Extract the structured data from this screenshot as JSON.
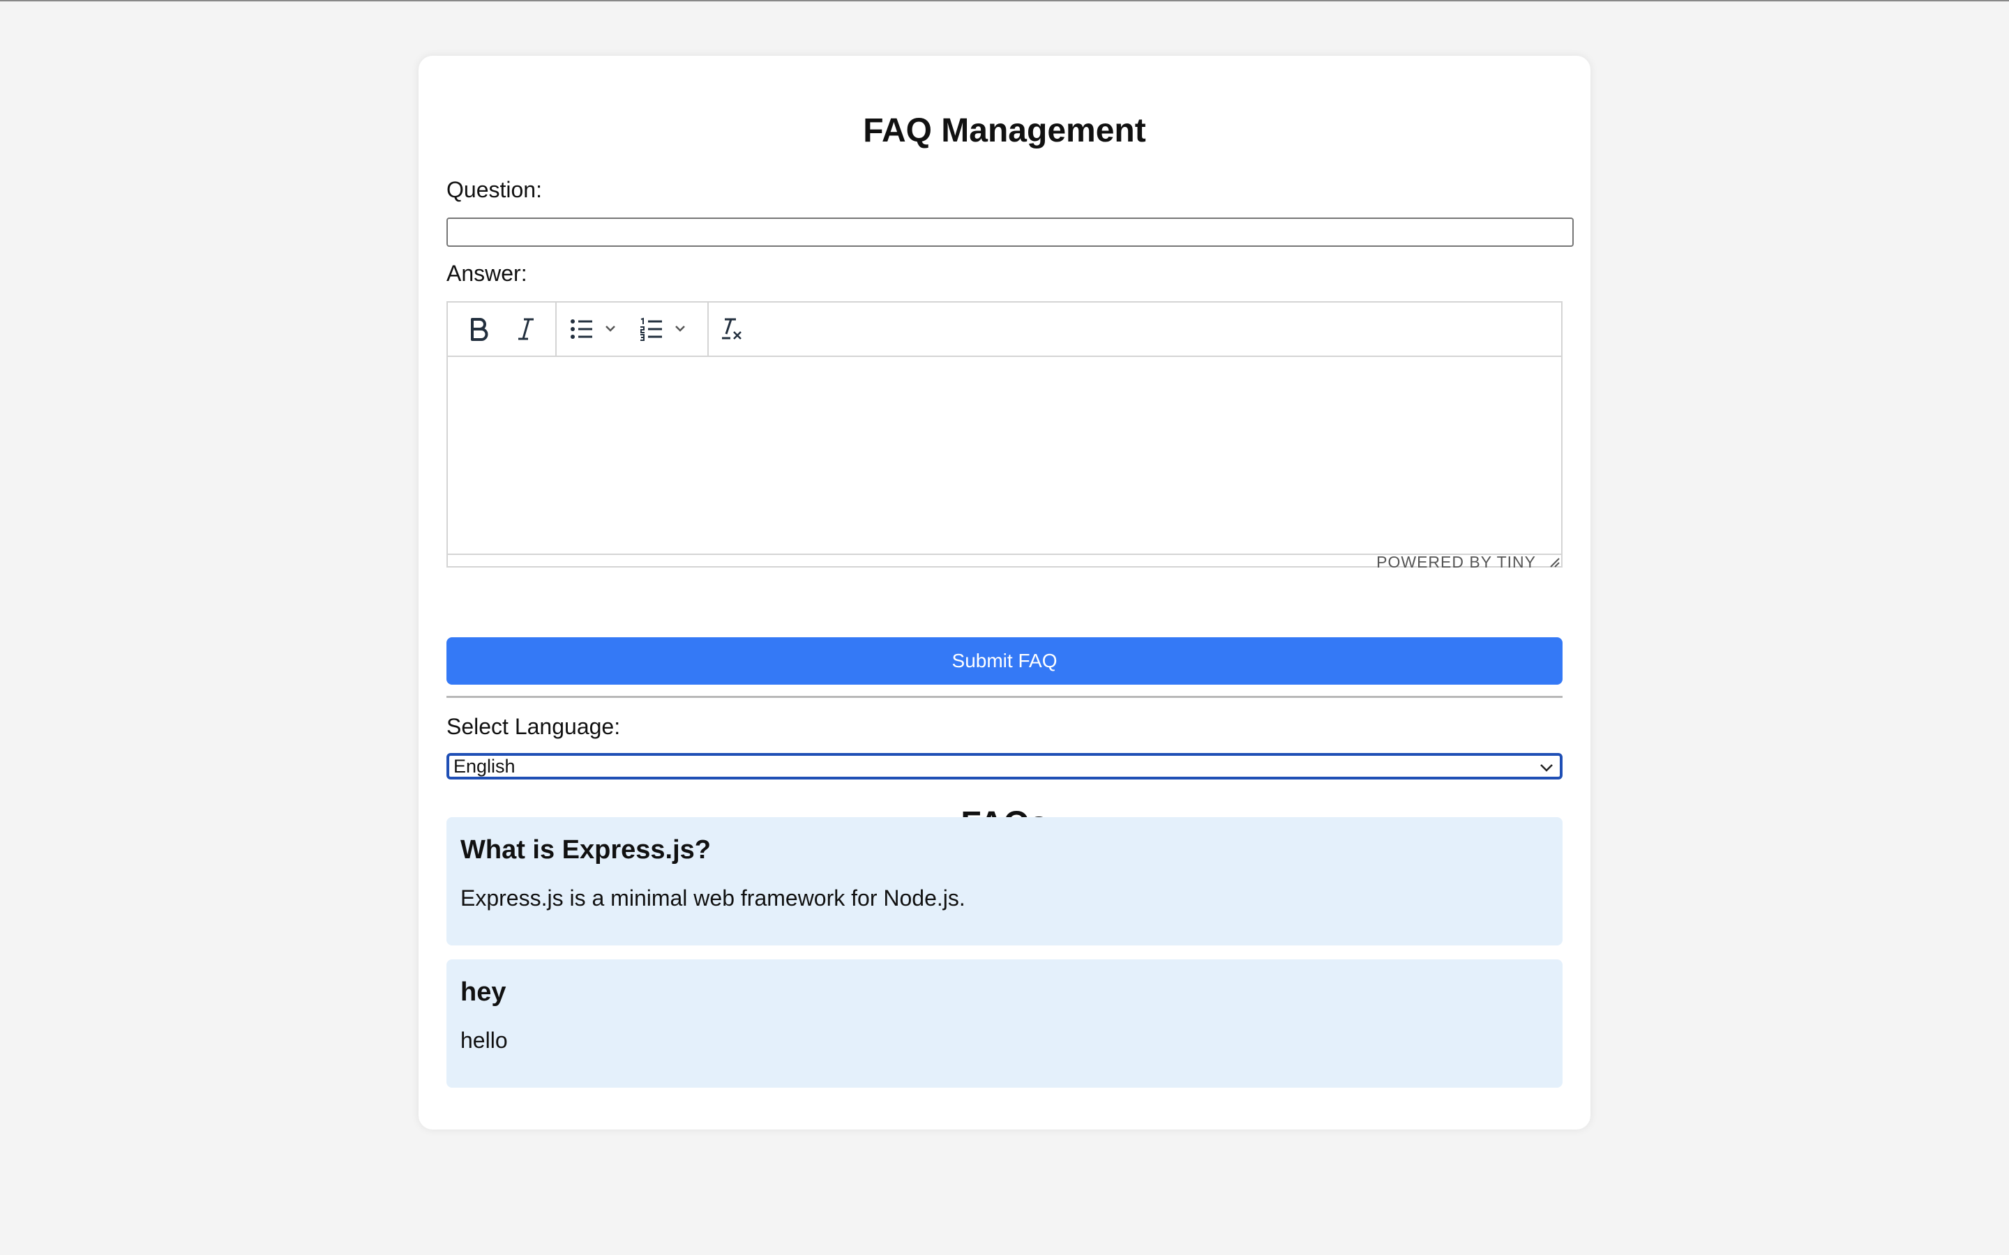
{
  "page": {
    "title": "FAQ Management"
  },
  "form": {
    "question_label": "Question:",
    "question_value": "",
    "answer_label": "Answer:",
    "editor": {
      "toolbar": [
        "bold-icon",
        "italic-icon",
        "bullet-list-icon",
        "numbered-list-icon",
        "clear-formatting-icon"
      ],
      "powered_by": "POWERED BY TINY"
    },
    "submit_label": "Submit FAQ"
  },
  "language": {
    "label": "Select Language:",
    "selected": "English"
  },
  "faqs": {
    "title": "FAQs",
    "items": [
      {
        "question": "What is Express.js?",
        "answer": "Express.js is a minimal web framework for Node.js."
      },
      {
        "question": "hey",
        "answer": "hello"
      }
    ]
  },
  "colors": {
    "accent": "#3479f6",
    "faq_bg": "#e4f0fb",
    "page_bg": "#f4f4f4"
  }
}
